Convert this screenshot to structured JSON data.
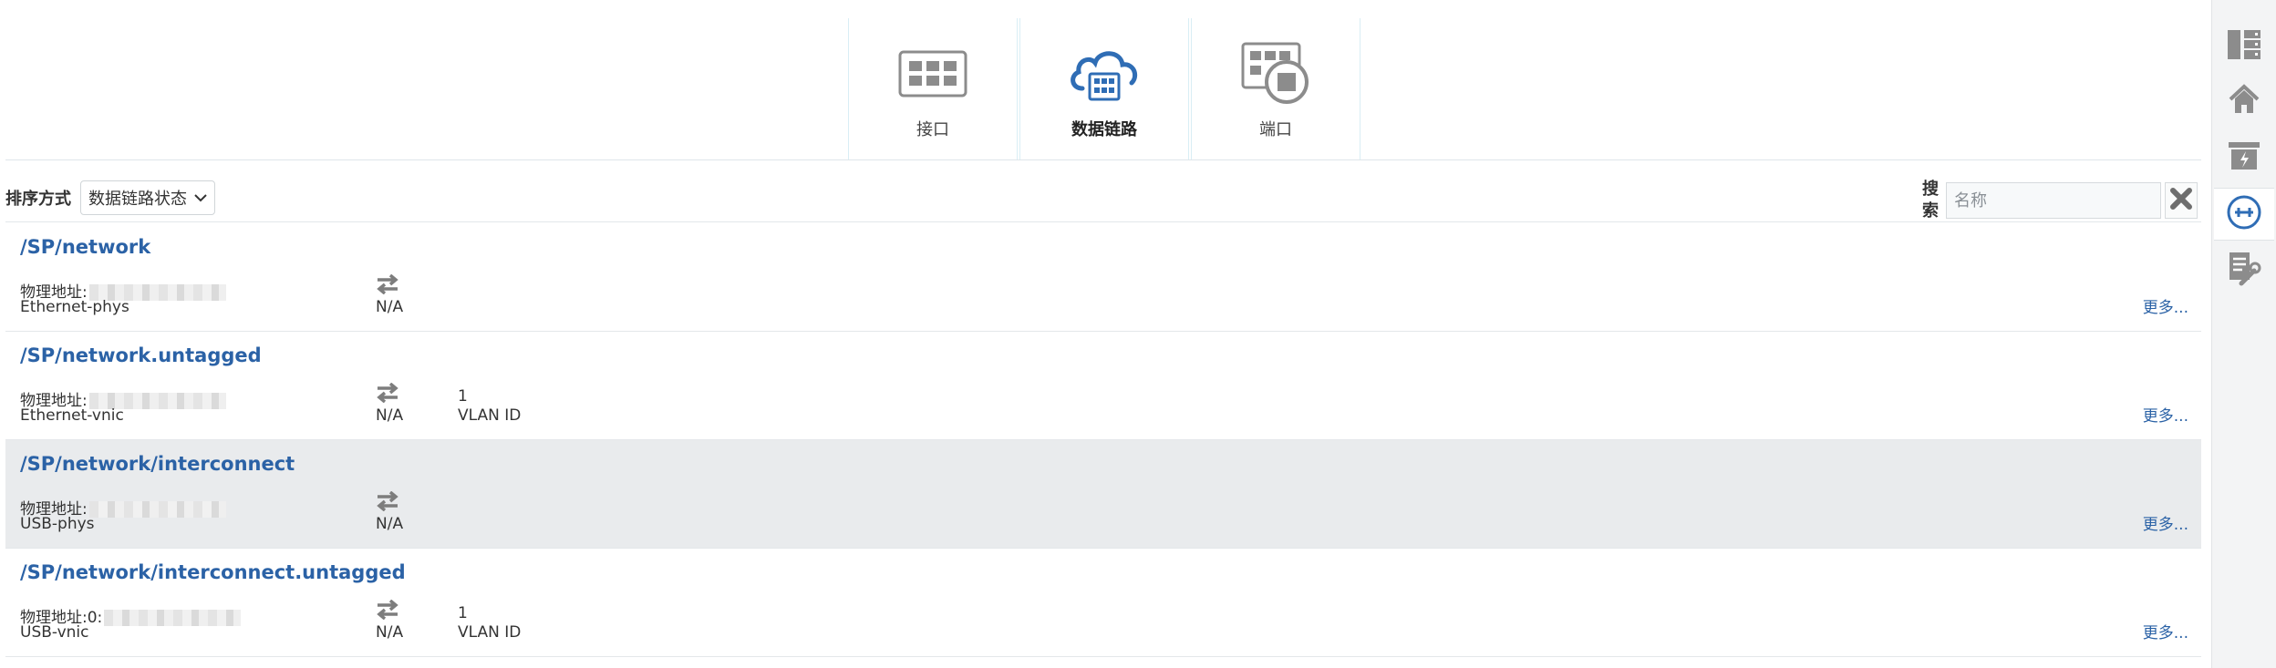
{
  "tabs": [
    {
      "label": "接口",
      "icon": "grid-icon",
      "active": false
    },
    {
      "label": "数据链路",
      "icon": "cloud-grid-icon",
      "active": true
    },
    {
      "label": "端口",
      "icon": "port-stop-icon",
      "active": false
    }
  ],
  "sort": {
    "label": "排序方式",
    "selected": "数据链路状态"
  },
  "search": {
    "label": "搜索",
    "placeholder": "名称",
    "value": ""
  },
  "rows": [
    {
      "title": "/SP/network",
      "address_label": "物理地址:",
      "address_visible": "",
      "type": "Ethernet-phys",
      "status": "N/A",
      "vlan_value": "",
      "vlan_label": "",
      "more": "更多...",
      "highlight": false
    },
    {
      "title": "/SP/network.untagged",
      "address_label": "物理地址:",
      "address_visible": "",
      "type": "Ethernet-vnic",
      "status": "N/A",
      "vlan_value": "1",
      "vlan_label": "VLAN ID",
      "more": "更多...",
      "highlight": false
    },
    {
      "title": "/SP/network/interconnect",
      "address_label": "物理地址:",
      "address_visible": "",
      "type": "USB-phys",
      "status": "N/A",
      "vlan_value": "",
      "vlan_label": "",
      "more": "更多...",
      "highlight": true
    },
    {
      "title": "/SP/network/interconnect.untagged",
      "address_label": "物理地址:",
      "address_visible": "0:",
      "type": "USB-vnic",
      "status": "N/A",
      "vlan_value": "1",
      "vlan_label": "VLAN ID",
      "more": "更多...",
      "highlight": false
    }
  ],
  "rail": [
    {
      "icon": "server-list-icon",
      "active": false
    },
    {
      "icon": "home-icon",
      "active": false
    },
    {
      "icon": "power-box-icon",
      "active": false
    },
    {
      "icon": "network-link-icon",
      "active": true
    },
    {
      "icon": "document-wrench-icon",
      "active": false
    }
  ],
  "colors": {
    "accent": "#2b62a6",
    "icon_gray": "#8c8c8c",
    "active_icon": "#2f6db5",
    "row_highlight": "#e9ebed"
  }
}
